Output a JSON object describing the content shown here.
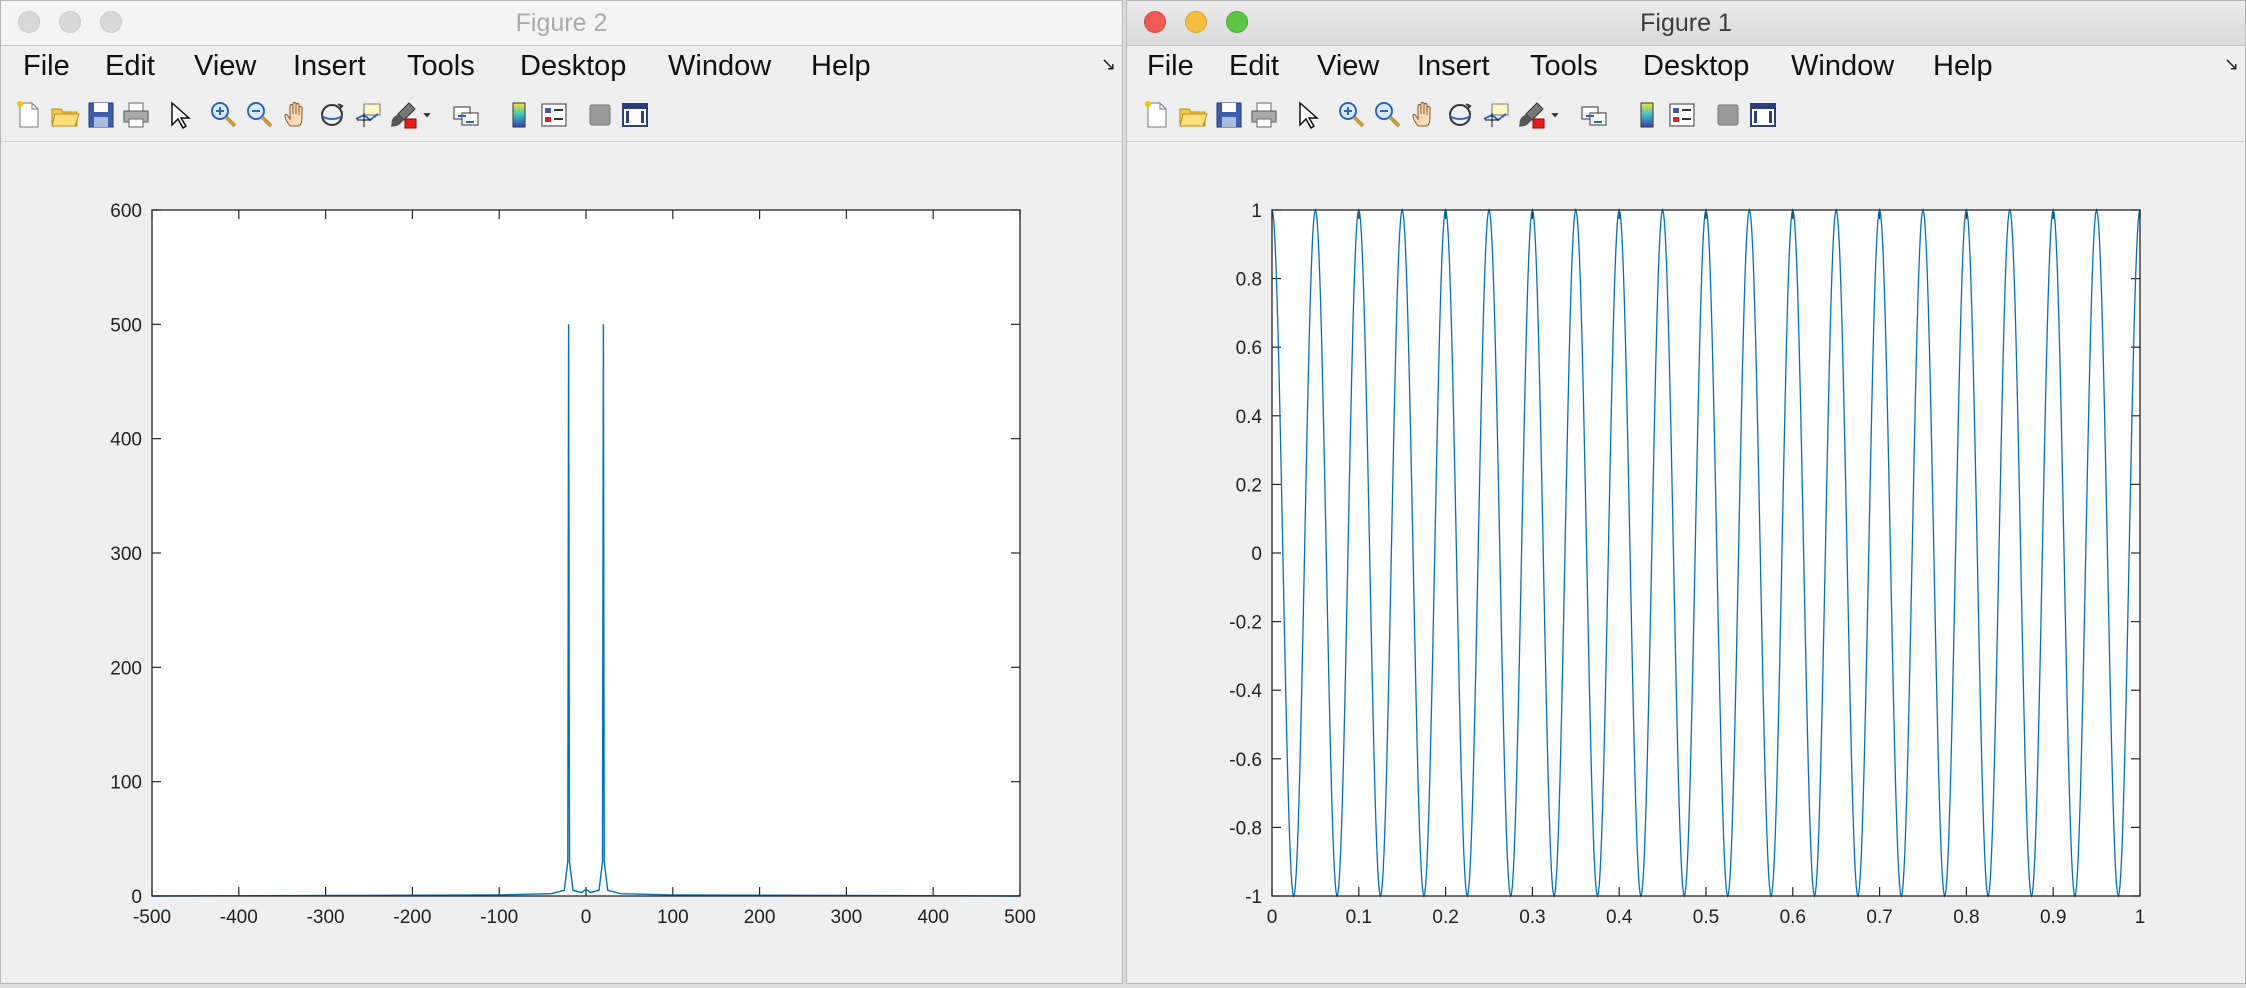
{
  "figure2": {
    "title": "Figure 2",
    "menu": [
      "File",
      "Edit",
      "View",
      "Insert",
      "Tools",
      "Desktop",
      "Window",
      "Help"
    ],
    "toolbar_icons": [
      "new-figure-icon",
      "open-file-icon",
      "save-icon",
      "print-icon",
      "pointer-icon",
      "zoom-in-icon",
      "zoom-out-icon",
      "pan-icon",
      "rotate-3d-icon",
      "data-cursor-icon",
      "brush-icon",
      "brush-dropdown-icon",
      "link-plot-icon",
      "colorbar-icon",
      "legend-icon",
      "hide-plot-tools-icon",
      "show-plot-tools-icon"
    ]
  },
  "figure1": {
    "title": "Figure 1",
    "menu": [
      "File",
      "Edit",
      "View",
      "Insert",
      "Tools",
      "Desktop",
      "Window",
      "Help"
    ],
    "toolbar_icons": [
      "new-figure-icon",
      "open-file-icon",
      "save-icon",
      "print-icon",
      "pointer-icon",
      "zoom-in-icon",
      "zoom-out-icon",
      "pan-icon",
      "rotate-3d-icon",
      "data-cursor-icon",
      "brush-icon",
      "brush-dropdown-icon",
      "link-plot-icon",
      "colorbar-icon",
      "legend-icon",
      "hide-plot-tools-icon",
      "show-plot-tools-icon"
    ]
  },
  "colors": {
    "line": "#0072bd",
    "axes": "#262626"
  },
  "chart_data": [
    {
      "type": "line",
      "title": "",
      "xlabel": "",
      "ylabel": "",
      "xlim": [
        -500,
        500
      ],
      "ylim": [
        0,
        600
      ],
      "xticks": [
        -500,
        -400,
        -300,
        -200,
        -100,
        0,
        100,
        200,
        300,
        400,
        500
      ],
      "yticks": [
        0,
        100,
        200,
        300,
        400,
        500,
        600
      ],
      "series": [
        {
          "x": [
            -500,
            -100,
            -40,
            -25,
            -21,
            -20,
            -19,
            -15,
            -5,
            0,
            5,
            15,
            19,
            20,
            21,
            25,
            40,
            100,
            500
          ],
          "y": [
            0,
            1,
            2,
            5,
            30,
            500,
            30,
            5,
            3,
            6,
            3,
            5,
            30,
            500,
            30,
            5,
            2,
            1,
            0
          ]
        }
      ]
    },
    {
      "type": "line",
      "title": "",
      "xlabel": "",
      "ylabel": "",
      "xlim": [
        0,
        1
      ],
      "ylim": [
        -1,
        1
      ],
      "xticks": [
        0,
        0.1,
        0.2,
        0.3,
        0.4,
        0.5,
        0.6,
        0.7,
        0.8,
        0.9,
        1
      ],
      "yticks": [
        -1,
        -0.8,
        -0.6,
        -0.4,
        -0.2,
        0,
        0.2,
        0.4,
        0.6,
        0.8,
        1
      ],
      "series": [
        {
          "function": "cos(2*pi*20*x)",
          "x_start": 0,
          "x_end": 1,
          "samples": 1001
        }
      ]
    }
  ]
}
